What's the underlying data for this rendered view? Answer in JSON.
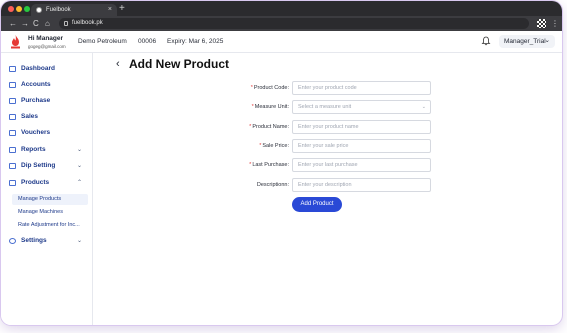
{
  "browser": {
    "tab_title": "Fuelbook",
    "tab_close": "×",
    "new_tab": "+",
    "url": "fuelbook.pk",
    "nav_back": "←",
    "nav_forward": "→",
    "nav_reload": "C",
    "nav_home": "⌂",
    "menu": "⋮",
    "colors": {
      "close": "#ff5f57",
      "minimize": "#febc2e",
      "maximize": "#28c840"
    }
  },
  "header": {
    "greeting": "Hi Manager",
    "email": "gogeg@gmail.com",
    "company": "Demo Petroleum",
    "code": "00006",
    "expiry": "Expiry: Mar 6, 2025",
    "user_menu": "Manager_Trial",
    "user_menu_chevron": "⌄",
    "icons": {
      "logo": "flame-logo-icon",
      "bell": "bell-icon"
    }
  },
  "sidebar": {
    "items": [
      {
        "label": "Dashboard",
        "icon": "dashboard-icon"
      },
      {
        "label": "Accounts",
        "icon": "accounts-icon"
      },
      {
        "label": "Purchase",
        "icon": "purchase-icon"
      },
      {
        "label": "Sales",
        "icon": "sales-icon"
      },
      {
        "label": "Vouchers",
        "icon": "vouchers-icon"
      },
      {
        "label": "Reports",
        "icon": "reports-icon",
        "chevron": "⌄"
      },
      {
        "label": "Dip Setting",
        "icon": "dip-setting-icon",
        "chevron": "⌄"
      },
      {
        "label": "Products",
        "icon": "products-icon",
        "chevron": "⌃"
      },
      {
        "label": "Settings",
        "icon": "settings-icon",
        "chevron": "⌄"
      }
    ],
    "products_sub": [
      {
        "label": "Manage Products",
        "active": true
      },
      {
        "label": "Manage Machines",
        "active": false
      },
      {
        "label": "Rate Adjustment for Inc...",
        "active": false
      }
    ]
  },
  "main": {
    "back": "‹",
    "title": "Add New Product",
    "fields": [
      {
        "label": "Product Code:",
        "required": true,
        "placeholder": "Enter your product code"
      },
      {
        "label": "Measure Unit:",
        "required": true,
        "placeholder": "Select a measure unit",
        "dropdown": "⌄"
      },
      {
        "label": "Product Name:",
        "required": true,
        "placeholder": "Enter your product name"
      },
      {
        "label": "Sale Price:",
        "required": true,
        "placeholder": "Enter your sale price"
      },
      {
        "label": "Last Purchase:",
        "required": true,
        "placeholder": "Enter your last purchase"
      },
      {
        "label": "Descriptionn:",
        "required": false,
        "placeholder": "Enter your description"
      }
    ],
    "required_mark": "*",
    "submit": "Add Product",
    "accent": "#2a49d6"
  }
}
